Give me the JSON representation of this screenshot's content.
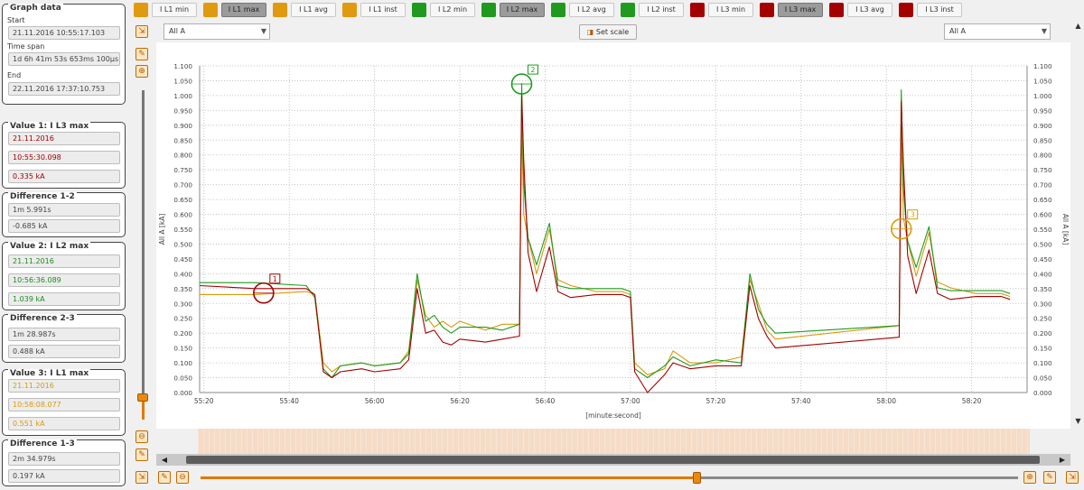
{
  "left": {
    "graph_data": {
      "title": "Graph data",
      "start_label": "Start",
      "start_value": "21.11.2016 10:55:17.103",
      "timespan_label": "Time span",
      "timespan_value": "1d 6h 41m 53s 653ms 100µs",
      "end_label": "End",
      "end_value": "22.11.2016 17:37:10.753"
    },
    "value1": {
      "title": "Value 1: I L3 max",
      "date": "21.11.2016",
      "time": "10:55:30.098",
      "value": "0.335 kA"
    },
    "diff12": {
      "title": "Difference 1-2",
      "time": "1m 5.991s",
      "value": "-0.685 kA"
    },
    "value2": {
      "title": "Value 2: I L2 max",
      "date": "21.11.2016",
      "time": "10:56:36.089",
      "value": "1.039 kA"
    },
    "diff23": {
      "title": "Difference 2-3",
      "time": "1m 28.987s",
      "value": "0.488 kA"
    },
    "value3": {
      "title": "Value 3: I L1 max",
      "date": "21.11.2016",
      "time": "10:58:08.077",
      "value": "0.551 kA"
    },
    "diff13": {
      "title": "Difference 1-3",
      "time": "2m 34.979s",
      "value": "0.197 kA"
    }
  },
  "toolbar": {
    "series_toggles": [
      {
        "label": "I L1 min",
        "color": "#e09a10",
        "active": false
      },
      {
        "label": "I L1 max",
        "color": "#e09a10",
        "active": true
      },
      {
        "label": "I L1 avg",
        "color": "#e09a10",
        "active": false
      },
      {
        "label": "I L1 inst",
        "color": "#e09a10",
        "active": false
      },
      {
        "label": "I L2 min",
        "color": "#1f9a1f",
        "active": false
      },
      {
        "label": "I L2 max",
        "color": "#1f9a1f",
        "active": true
      },
      {
        "label": "I L2 avg",
        "color": "#1f9a1f",
        "active": false
      },
      {
        "label": "I L2 inst",
        "color": "#1f9a1f",
        "active": false
      },
      {
        "label": "I L3 min",
        "color": "#a40000",
        "active": false
      },
      {
        "label": "I L3 max",
        "color": "#a40000",
        "active": true
      },
      {
        "label": "I L3 avg",
        "color": "#a40000",
        "active": false
      },
      {
        "label": "I L3 inst",
        "color": "#a40000",
        "active": false
      }
    ],
    "left_axis_select": "All A",
    "right_axis_select": "All A",
    "set_scale_label": "Set scale"
  },
  "colors": {
    "accent": "#e07a00",
    "l1": "#d89a0a",
    "l2": "#1f9a1f",
    "l3": "#a40000"
  },
  "chart_data": {
    "type": "line",
    "xlabel": "[minute:second]",
    "ylabel": "All A [kA]",
    "ylabel_right": "All A [kA]",
    "x_unit": "seconds after 55:00",
    "xlim": [
      19,
      154
    ],
    "ylim": [
      0,
      1.1
    ],
    "yticks": [
      0,
      0.05,
      0.1,
      0.15,
      0.2,
      0.25,
      0.3,
      0.35,
      0.4,
      0.45,
      0.5,
      0.55,
      0.6,
      0.65,
      0.7,
      0.75,
      0.8,
      0.85,
      0.9,
      0.95,
      1.0,
      1.05,
      1.1
    ],
    "ytick_labels": [
      "0.000",
      "0.050",
      "0.100",
      "0.150",
      "0.200",
      "0.250",
      "0.300",
      "0.350",
      "0.400",
      "0.450",
      "0.500",
      "0.550",
      "0.600",
      "0.650",
      "0.700",
      "0.750",
      "0.800",
      "0.850",
      "0.900",
      "0.950",
      "1.000",
      "1.050",
      "1.100"
    ],
    "xticks": [
      20,
      40,
      60,
      80,
      100,
      120,
      140
    ],
    "xtick_labels": [
      "55:20",
      "55:40",
      "56:00",
      "56:20",
      "56:40",
      "57:00",
      "57:20",
      "57:40",
      "58:00",
      "58:20"
    ],
    "xtick_seconds": [
      20,
      40,
      60,
      80,
      100,
      120,
      140,
      160,
      180,
      200
    ],
    "grid": true,
    "series": [
      {
        "name": "I L1 max",
        "color": "#d89a0a",
        "dashed_start": true,
        "points": [
          [
            19,
            0.33
          ],
          [
            32,
            0.33
          ],
          [
            44,
            0.34
          ],
          [
            46,
            0.33
          ],
          [
            48,
            0.1
          ],
          [
            50,
            0.07
          ],
          [
            52,
            0.09
          ],
          [
            57,
            0.1
          ],
          [
            60,
            0.09
          ],
          [
            66,
            0.1
          ],
          [
            68,
            0.14
          ],
          [
            70,
            0.38
          ],
          [
            72,
            0.26
          ],
          [
            74,
            0.22
          ],
          [
            76,
            0.24
          ],
          [
            78,
            0.22
          ],
          [
            80,
            0.24
          ],
          [
            86,
            0.21
          ],
          [
            90,
            0.23
          ],
          [
            94,
            0.23
          ],
          [
            94.5,
            0.9
          ],
          [
            95,
            0.6
          ],
          [
            96,
            0.52
          ],
          [
            98,
            0.4
          ],
          [
            101,
            0.55
          ],
          [
            103,
            0.38
          ],
          [
            106,
            0.36
          ],
          [
            112,
            0.34
          ],
          [
            118,
            0.34
          ],
          [
            120,
            0.33
          ],
          [
            121,
            0.1
          ],
          [
            124,
            0.06
          ],
          [
            128,
            0.08
          ],
          [
            130,
            0.14
          ],
          [
            134,
            0.1
          ],
          [
            140,
            0.1
          ],
          [
            146,
            0.12
          ],
          [
            148,
            0.38
          ],
          [
            150,
            0.3
          ],
          [
            152,
            0.21
          ],
          [
            154,
            0.18
          ]
        ]
      },
      {
        "name": "I L2 max",
        "color": "#1f9a1f",
        "points": [
          [
            19,
            0.37
          ],
          [
            32,
            0.37
          ],
          [
            44,
            0.36
          ],
          [
            46,
            0.32
          ],
          [
            48,
            0.08
          ],
          [
            50,
            0.05
          ],
          [
            52,
            0.09
          ],
          [
            57,
            0.1
          ],
          [
            60,
            0.09
          ],
          [
            66,
            0.1
          ],
          [
            68,
            0.13
          ],
          [
            70,
            0.4
          ],
          [
            72,
            0.24
          ],
          [
            74,
            0.26
          ],
          [
            76,
            0.22
          ],
          [
            78,
            0.2
          ],
          [
            80,
            0.22
          ],
          [
            86,
            0.22
          ],
          [
            90,
            0.21
          ],
          [
            94,
            0.23
          ],
          [
            94.5,
            1.04
          ],
          [
            95,
            0.7
          ],
          [
            96,
            0.52
          ],
          [
            98,
            0.43
          ],
          [
            101,
            0.57
          ],
          [
            103,
            0.36
          ],
          [
            106,
            0.35
          ],
          [
            112,
            0.35
          ],
          [
            118,
            0.35
          ],
          [
            120,
            0.34
          ],
          [
            121,
            0.08
          ],
          [
            124,
            0.05
          ],
          [
            128,
            0.09
          ],
          [
            130,
            0.12
          ],
          [
            134,
            0.09
          ],
          [
            140,
            0.11
          ],
          [
            146,
            0.1
          ],
          [
            148,
            0.4
          ],
          [
            150,
            0.28
          ],
          [
            152,
            0.23
          ],
          [
            154,
            0.2
          ]
        ]
      },
      {
        "name": "I L3 max",
        "color": "#a40000",
        "points": [
          [
            19,
            0.36
          ],
          [
            32,
            0.35
          ],
          [
            44,
            0.35
          ],
          [
            46,
            0.33
          ],
          [
            48,
            0.07
          ],
          [
            50,
            0.05
          ],
          [
            52,
            0.07
          ],
          [
            57,
            0.08
          ],
          [
            60,
            0.07
          ],
          [
            66,
            0.08
          ],
          [
            68,
            0.11
          ],
          [
            70,
            0.35
          ],
          [
            72,
            0.2
          ],
          [
            74,
            0.21
          ],
          [
            76,
            0.17
          ],
          [
            78,
            0.16
          ],
          [
            80,
            0.18
          ],
          [
            86,
            0.17
          ],
          [
            90,
            0.18
          ],
          [
            94,
            0.19
          ],
          [
            94.5,
            1.0
          ],
          [
            95,
            0.78
          ],
          [
            96,
            0.47
          ],
          [
            98,
            0.34
          ],
          [
            101,
            0.49
          ],
          [
            103,
            0.34
          ],
          [
            106,
            0.32
          ],
          [
            112,
            0.33
          ],
          [
            118,
            0.33
          ],
          [
            120,
            0.32
          ],
          [
            121,
            0.07
          ],
          [
            124,
            0.0
          ],
          [
            128,
            0.06
          ],
          [
            130,
            0.1
          ],
          [
            134,
            0.08
          ],
          [
            140,
            0.09
          ],
          [
            146,
            0.09
          ],
          [
            148,
            0.36
          ],
          [
            150,
            0.25
          ],
          [
            152,
            0.19
          ],
          [
            154,
            0.15
          ]
        ]
      }
    ],
    "cursors": [
      {
        "label": "1",
        "x": 34,
        "y": 0.335,
        "color": "#a40000"
      },
      {
        "label": "2",
        "x": 94.5,
        "y": 1.039,
        "color": "#1f9a1f"
      },
      {
        "label": "3",
        "x": 183.5,
        "y": 0.551,
        "color": "#d89a0a"
      }
    ]
  }
}
